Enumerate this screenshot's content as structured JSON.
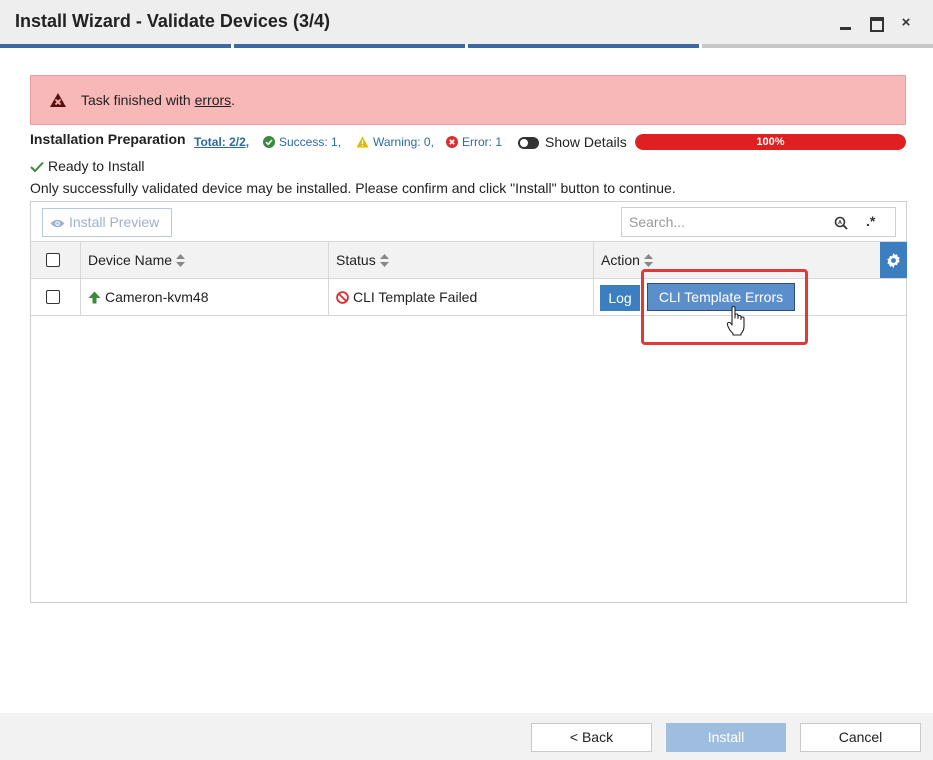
{
  "window": {
    "title": "Install Wizard - Validate Devices (3/4)",
    "close_glyph": "×",
    "steps": [
      {
        "state": "done"
      },
      {
        "state": "done"
      },
      {
        "state": "done"
      },
      {
        "state": "todo"
      }
    ]
  },
  "alert": {
    "prefix": "Task finished with ",
    "link": "errors",
    "suffix": ".",
    "background_color": "#f8b8b8"
  },
  "preparation": {
    "title": "Installation Preparation",
    "total": "Total: 2/2,",
    "success": "Success: 1,",
    "warning": "Warning: 0,",
    "error": "Error: 1",
    "show_details_label": "Show Details",
    "progress_percent": 100,
    "progress_label": "100%",
    "progress_color": "#e02020"
  },
  "status": {
    "ready": "Ready to Install",
    "note": "Only successfully validated device may be installed. Please confirm and click \"Install\" button to continue."
  },
  "toolbar": {
    "install_preview": "Install Preview",
    "search_placeholder": "Search...",
    "regex_glyph": ".*"
  },
  "table": {
    "columns": {
      "device_name": "Device Name",
      "status": "Status",
      "action": "Action"
    },
    "rows": [
      {
        "device_name": "Cameron-kvm48",
        "status": "CLI Template Failed",
        "actions": {
          "log": "Log",
          "errors": "CLI Template Errors"
        }
      }
    ]
  },
  "footer": {
    "back": "< Back",
    "install": "Install",
    "cancel": "Cancel"
  },
  "icons": {
    "alert": "warning-triangle-icon",
    "success": "check-circle-icon",
    "warning": "warning-icon",
    "error": "x-circle-icon",
    "ready": "checkmark-icon",
    "preview": "eye-icon",
    "search": "search-icon",
    "regex": "regex-icon",
    "settings": "gear-icon",
    "device": "up-arrow-icon",
    "status": "prohibited-icon",
    "cursor": "hand-cursor-icon"
  },
  "colors": {
    "accent": "#3c7fc1",
    "success": "#3c8a3c",
    "warning": "#e5b900",
    "error": "#d83030",
    "highlight": "#e0393b"
  }
}
